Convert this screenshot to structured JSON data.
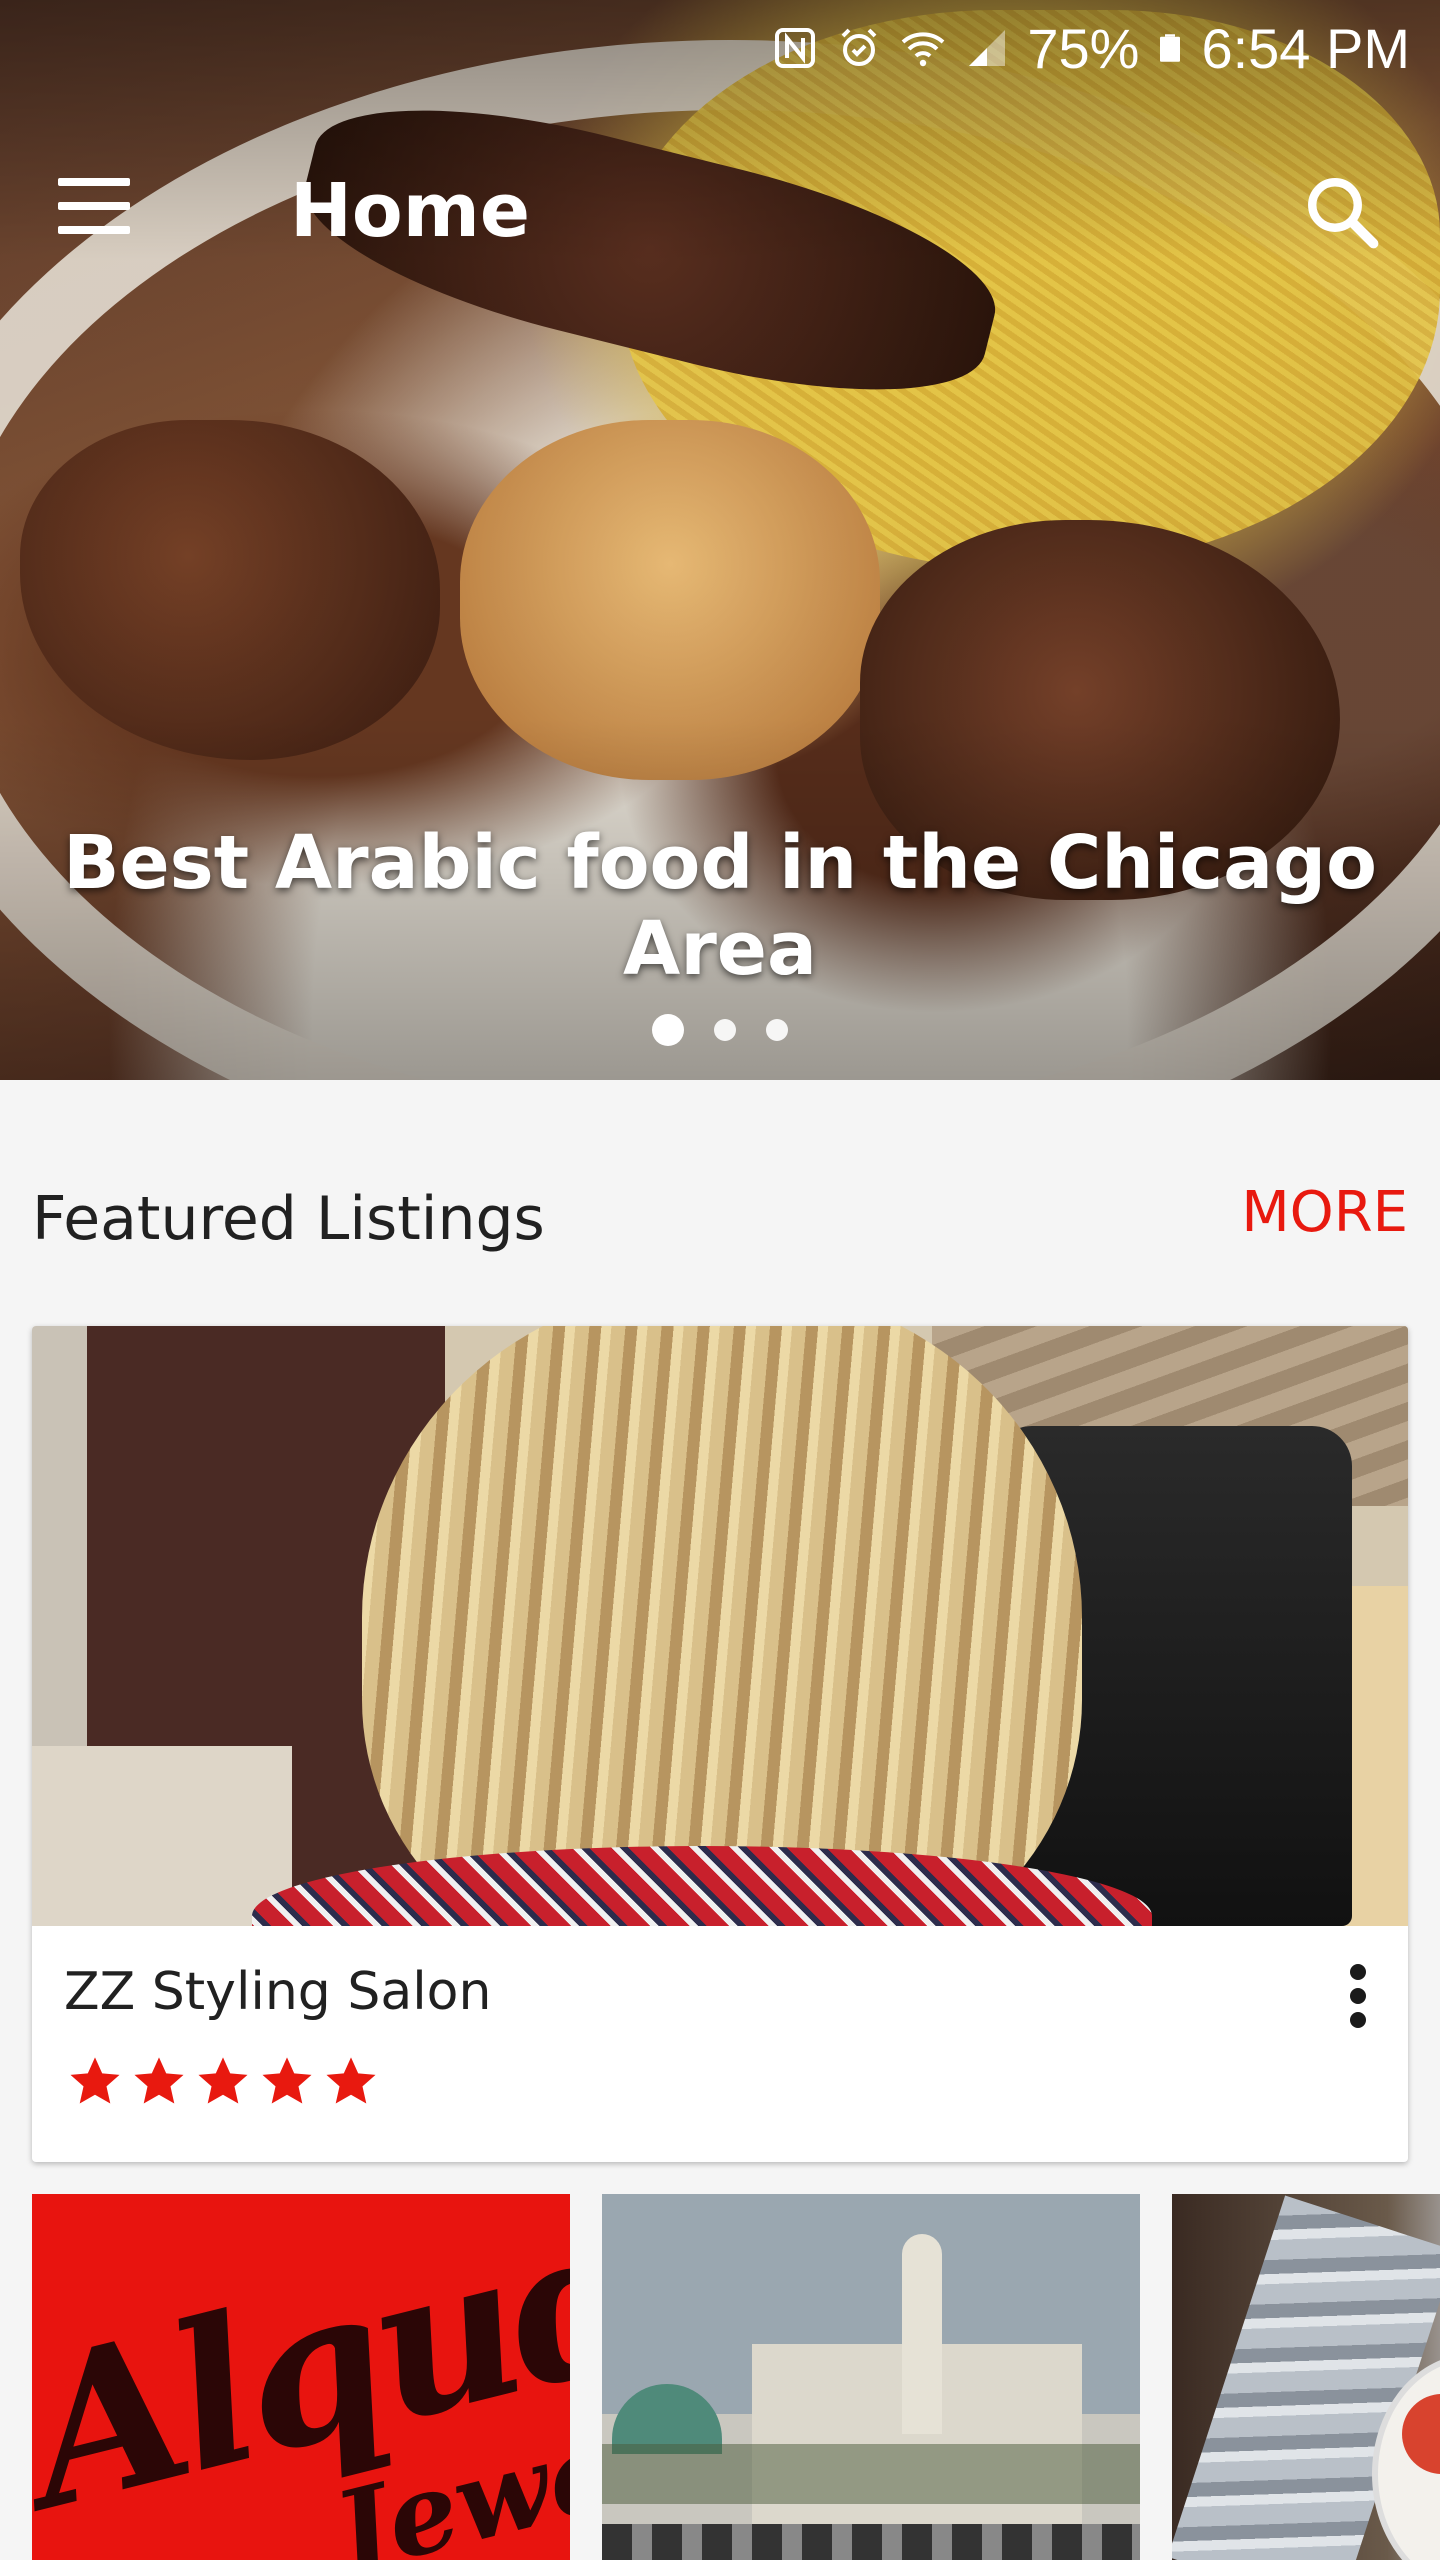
{
  "status_bar": {
    "icons": [
      "nfc-icon",
      "alarm-icon",
      "wifi-icon",
      "signal-icon",
      "battery-icon"
    ],
    "battery": "75%",
    "time": "6:54 PM"
  },
  "app_bar": {
    "title": "Home"
  },
  "hero": {
    "caption": "Best Arabic food in the Chicago Area",
    "pager": {
      "count": 3,
      "active_index": 0
    }
  },
  "featured": {
    "title": "Featured Listings",
    "more_label": "MORE",
    "card": {
      "name": "ZZ Styling Salon",
      "rating": 5,
      "rating_max": 5
    }
  },
  "thumbnails": [
    {
      "logo_text": "Alquds",
      "logo_subtext": "Jewelr"
    },
    {
      "icon": "mosque-photo"
    },
    {
      "icon": "food-photo"
    }
  ],
  "colors": {
    "accent": "#e8190f",
    "star": "#e8190f",
    "background": "#f5f5f5"
  }
}
